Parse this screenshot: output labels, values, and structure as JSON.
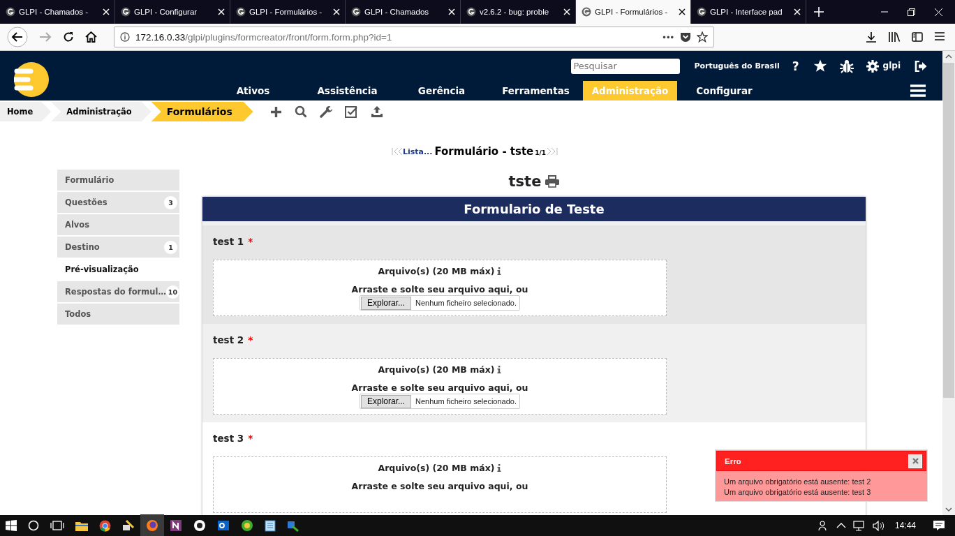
{
  "browser": {
    "tabs": [
      {
        "title": "GLPI - Chamados -",
        "selected": false
      },
      {
        "title": "GLPI - Configurar",
        "selected": false
      },
      {
        "title": "GLPI - Formulários -",
        "selected": false
      },
      {
        "title": "GLPI - Chamados",
        "selected": false
      },
      {
        "title": "v2.6.2 - bug: proble",
        "selected": false
      },
      {
        "title": "GLPI - Formulários -",
        "selected": true
      },
      {
        "title": "GLPI - Interface pad",
        "selected": false
      }
    ],
    "url_host": "172.16.0.33",
    "url_path": "/glpi/plugins/formcreator/front/form.form.php?id=1",
    "page_actions": "•••"
  },
  "header": {
    "search": {
      "placeholder": "Pesquisar"
    },
    "language": "Português do Brasil",
    "help": "?",
    "user": "glpi",
    "menu": [
      {
        "label": "Ativos",
        "selected": false
      },
      {
        "label": "Assistência",
        "selected": false
      },
      {
        "label": "Gerência",
        "selected": false
      },
      {
        "label": "Ferramentas",
        "selected": false
      },
      {
        "label": "Administração",
        "selected": true
      },
      {
        "label": "Configurar",
        "selected": false
      }
    ]
  },
  "breadcrumb": [
    {
      "label": "Home",
      "selected": false
    },
    {
      "label": "Administração",
      "selected": false
    },
    {
      "label": "Formulários",
      "selected": true
    }
  ],
  "page_nav": {
    "list_link": "Lista...",
    "title": "Formulário - tste",
    "counter": "1/1"
  },
  "sidebar": {
    "items": [
      {
        "label": "Formulário",
        "selected": false
      },
      {
        "label": "Questões",
        "count": "3",
        "selected": false
      },
      {
        "label": "Alvos",
        "selected": false
      },
      {
        "label": "Destino",
        "count": "1",
        "selected": false
      },
      {
        "label": "Pré-visualização",
        "selected": true
      },
      {
        "label": "Respostas do formul…",
        "count": "10",
        "selected": false
      },
      {
        "label": "Todos",
        "selected": false
      }
    ]
  },
  "form": {
    "name": "tste",
    "title": "Formulario de Teste",
    "questions": [
      {
        "label": "test 1",
        "required_mark": "*",
        "file_label": "Arquivo(s) (20 MB máx)",
        "drop_text": "Arraste e solte seu arquivo aqui, ou",
        "button": "Explorar...",
        "file_status": "Nenhum ficheiro selecionado."
      },
      {
        "label": "test 2",
        "required_mark": "*",
        "file_label": "Arquivo(s) (20 MB máx)",
        "drop_text": "Arraste e solte seu arquivo aqui, ou",
        "button": "Explorar...",
        "file_status": "Nenhum ficheiro selecionado."
      },
      {
        "label": "test 3",
        "required_mark": "*",
        "file_label": "Arquivo(s) (20 MB máx)",
        "drop_text": "Arraste e solte seu arquivo aqui, ou"
      }
    ]
  },
  "error": {
    "title": "Erro",
    "messages": [
      "Um arquivo obrigatório está ausente: test 2",
      "Um arquivo obrigatório está ausente: test 3"
    ]
  },
  "taskbar": {
    "clock": "14:44"
  }
}
